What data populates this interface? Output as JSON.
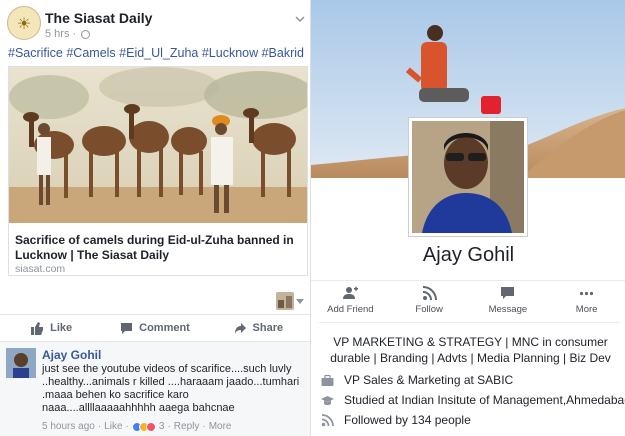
{
  "post": {
    "page_name": "The Siasat Daily",
    "page_avatar_glyph": "☀",
    "time": "5 hrs",
    "meta_separator": "·",
    "hashtags": "#Sacrifice #Camels #Eid_Ul_Zuha #Lucknow #Bakrid",
    "link": {
      "title": "Sacrifice of camels during Eid-ul-Zuha banned in Lucknow | The Siasat Daily",
      "domain": "siasat.com"
    },
    "actions": {
      "like": "Like",
      "comment": "Comment",
      "share": "Share"
    }
  },
  "comment": {
    "author": "Ajay Gohil",
    "text": "just see the youtube videos of scarifice....such luvly ..healthy...animals r killed ....haraaam jaado...tumhari .maaa behen ko sacrifice karo naaa....allllaaaaahhhhh aaega bahcnae",
    "time": "5 hours ago",
    "like": "Like",
    "reaction_count": "3",
    "reply": "Reply",
    "more": "More",
    "sep": "·"
  },
  "profile": {
    "name": "Ajay Gohil",
    "actions": {
      "add_friend": "Add Friend",
      "follow": "Follow",
      "message": "Message",
      "more": "More"
    },
    "headline": "VP MARKETING & STRATEGY | MNC in consumer durable | Branding | Advts | Media Planning | Biz Dev",
    "work": "VP Sales & Marketing at SABIC",
    "education": "Studied at Indian Insitute of Management,Ahmedabad",
    "followers": "Followed by 134 people"
  },
  "colors": {
    "link_blue": "#365899",
    "meta_gray": "#90949c",
    "sky_top": "#b9d3ea",
    "sand": "#c9a27a"
  }
}
